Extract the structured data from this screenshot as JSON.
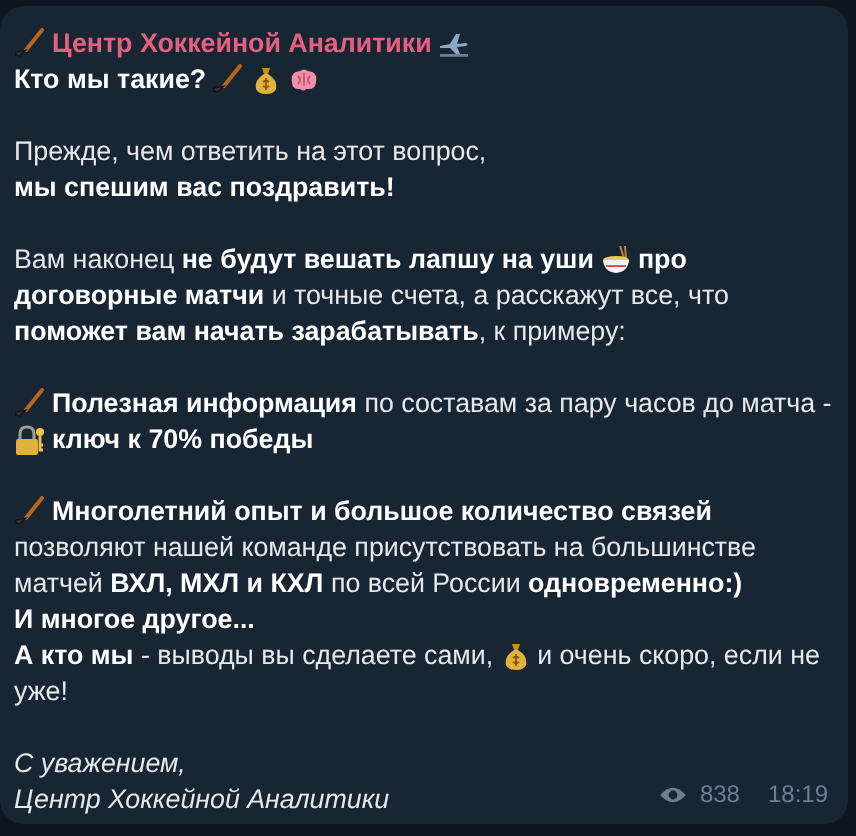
{
  "message": {
    "sender": {
      "name": "Центр Хоккейной Аналитики",
      "before": {
        "kind": "stick"
      },
      "after": {
        "kind": "plane"
      }
    },
    "paragraphs": [
      {
        "kind": "body",
        "lines": [
          [
            {
              "kind": "text",
              "text": "**Кто мы такие?**"
            },
            {
              "kind": "stick"
            },
            {
              "kind": "bag"
            },
            {
              "kind": "brain"
            }
          ]
        ]
      },
      {
        "kind": "body",
        "lines": [
          [
            {
              "kind": "text",
              "text": "Прежде, чем ответить на этот вопрос,"
            }
          ],
          [
            {
              "kind": "text",
              "text": "**мы спешим вас поздравить!**"
            }
          ]
        ]
      },
      {
        "kind": "body",
        "lines": [
          [
            {
              "kind": "text",
              "text": "Вам наконец **не будут вешать лапшу на уши**"
            },
            {
              "kind": "noodles"
            },
            {
              "kind": "text",
              "text": "**про**"
            }
          ],
          [
            {
              "kind": "text",
              "text": "**договорные матчи** и точные счета, а расскажут все, что"
            }
          ],
          [
            {
              "kind": "text",
              "text": "**поможет вам начать зарабатывать**, к примеру:"
            }
          ]
        ]
      },
      {
        "kind": "body",
        "lines": [
          [
            {
              "kind": "stick"
            },
            {
              "kind": "text",
              "text": "**Полезная информация** по составам за пару часов до матча -"
            }
          ],
          [
            {
              "kind": "lock"
            },
            {
              "kind": "text",
              "text": "**ключ к 70% победы**"
            }
          ]
        ]
      },
      {
        "kind": "body",
        "lines": [
          [
            {
              "kind": "stick"
            },
            {
              "kind": "text",
              "text": "**Многолетний опыт и большое количество связей**"
            }
          ],
          [
            {
              "kind": "text",
              "text": "позволяют нашей команде присутствовать на большинстве"
            }
          ],
          [
            {
              "kind": "text",
              "text": "матчей **ВХЛ, МХЛ и КХЛ** по всей России **одновременно:)**"
            }
          ],
          [
            {
              "kind": "text",
              "text": "**И многое другое...**"
            }
          ],
          [
            {
              "kind": "text",
              "text": "**А кто мы** - выводы вы сделаете сами,"
            },
            {
              "kind": "bag"
            },
            {
              "kind": "text",
              "text": "и очень скоро, если не"
            }
          ],
          [
            {
              "kind": "text",
              "text": "уже!"
            }
          ]
        ]
      },
      {
        "kind": "signature",
        "lines": [
          [
            {
              "kind": "text",
              "text": "С уважением,"
            }
          ],
          [
            {
              "kind": "text",
              "text": "Центр Хоккейной Аналитики"
            }
          ]
        ]
      }
    ],
    "views": "838",
    "time": "18:19"
  }
}
